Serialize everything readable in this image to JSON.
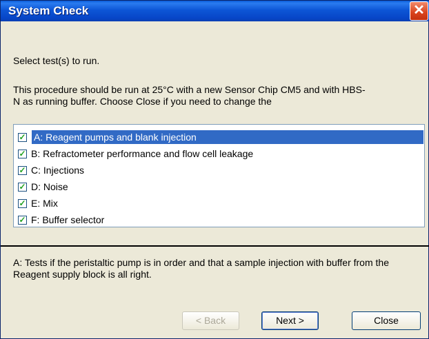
{
  "window": {
    "title": "System Check",
    "close_symbol": "✕"
  },
  "intro": "Select test(s) to run.",
  "description": "This procedure should be run at 25°C with a new Sensor Chip CM5 and with HBS-N as running buffer. Choose Close if you need to change the",
  "tests": [
    {
      "label": "A: Reagent pumps and blank injection",
      "checked": true,
      "selected": true
    },
    {
      "label": "B: Refractometer performance and flow cell leakage",
      "checked": true,
      "selected": false
    },
    {
      "label": "C: Injections",
      "checked": true,
      "selected": false
    },
    {
      "label": "D: Noise",
      "checked": true,
      "selected": false
    },
    {
      "label": "E: Mix",
      "checked": true,
      "selected": false
    },
    {
      "label": "F: Buffer selector",
      "checked": true,
      "selected": false
    }
  ],
  "info": "A: Tests if the peristaltic pump is in order and that a sample injection with buffer from the Reagent supply block is all right.",
  "buttons": {
    "back": "< Back",
    "next": "Next >",
    "close": "Close"
  },
  "colors": {
    "titlebar": "#0a5bd9",
    "selection": "#316ac5",
    "check": "#21a121"
  }
}
